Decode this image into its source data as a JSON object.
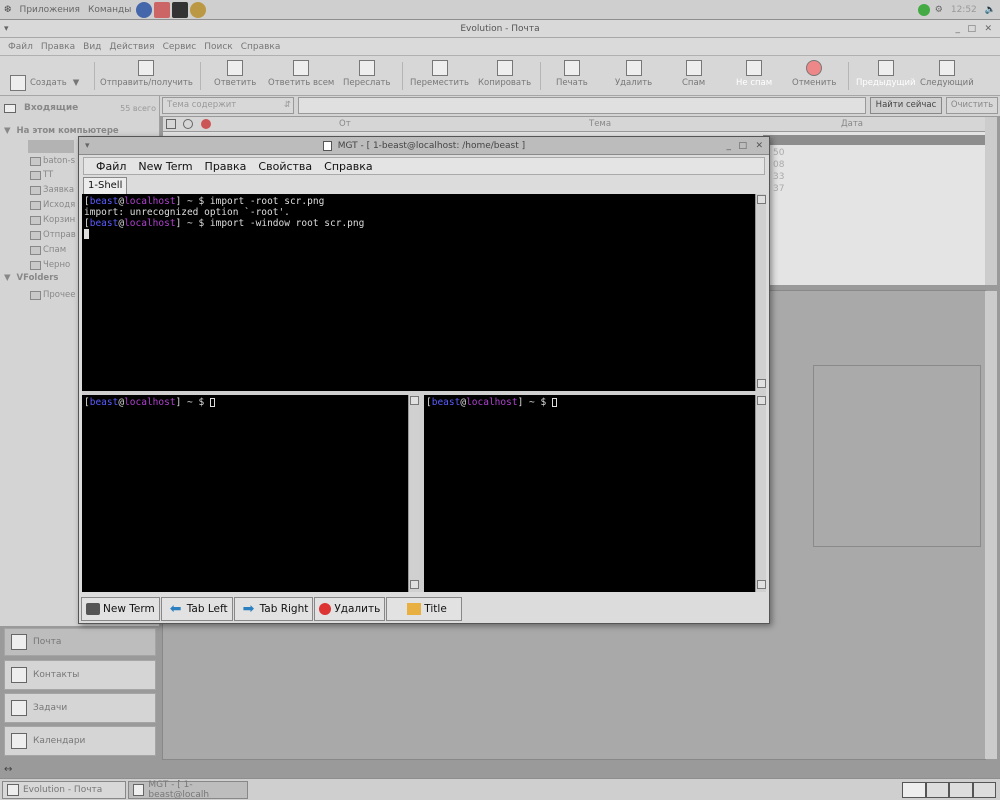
{
  "top_panel": {
    "menus": [
      "Приложения",
      "Команды"
    ],
    "clock": "12:52"
  },
  "evolution": {
    "title": "Evolution - Почта",
    "menu": [
      "Файл",
      "Правка",
      "Вид",
      "Действия",
      "Сервис",
      "Поиск",
      "Справка"
    ],
    "toolbar": [
      "Создать",
      "Отправить/получить",
      "Ответить",
      "Ответить всем",
      "Переслать",
      "Переместить",
      "Копировать",
      "Печать",
      "Удалить",
      "Спам",
      "Не спам",
      "Отменить",
      "Предыдущий",
      "Следующий"
    ],
    "folder_header": "Входящие",
    "folder_count": "55 всего",
    "local_group": "На этом компьютере",
    "folders": [
      "baton-s",
      "TT",
      "Заявка",
      "Исходя",
      "Корзин",
      "Отправ",
      "Спам",
      "Черно"
    ],
    "vfolders": "VFolders",
    "vfolder_items": [
      "Прочее"
    ],
    "search_scope": "Тема содержит",
    "search_btn": "Найти сейчас",
    "clear_btn": "Очистить",
    "columns": [
      "От",
      "Тема",
      "Дата"
    ],
    "dates": [
      "50",
      "08",
      "33",
      "37"
    ],
    "nav": [
      "Почта",
      "Контакты",
      "Задачи",
      "Календари"
    ]
  },
  "mgt": {
    "title": "MGT - [ 1-beast@localhost: /home/beast ]",
    "menu": [
      "Файл",
      "New Term",
      "Правка",
      "Свойства",
      "Справка"
    ],
    "tab": "1-Shell",
    "term_top": {
      "line1_cmd": " ~ $ import -root scr.png",
      "line2": "import: unrecognized option `-root'.",
      "line3_cmd": " ~ $ import -window root scr.png"
    },
    "prompt_user": "beast",
    "prompt_at": "@",
    "prompt_host": "localhost",
    "prompt_rest": " ~ $ ",
    "buttons": [
      "New Term",
      "Tab Left",
      "Tab Right",
      "Удалить",
      "Title"
    ]
  },
  "taskbar": {
    "items": [
      "Evolution - Почта",
      "MGT - [ 1-beast@localh"
    ]
  }
}
